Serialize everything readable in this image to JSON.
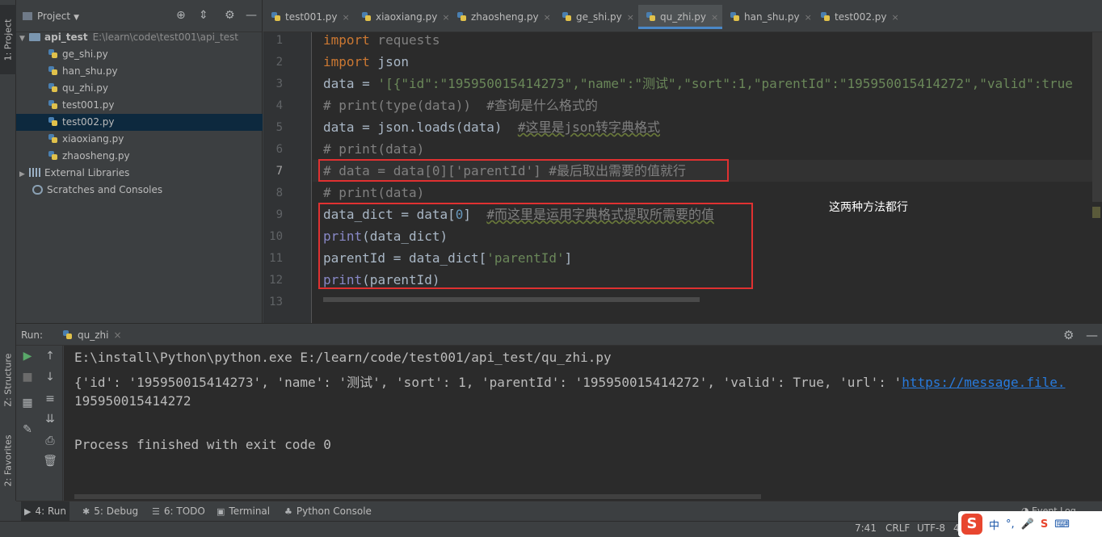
{
  "left_strip": {
    "project_tab": "1: Project",
    "structure_tab": "Z: Structure",
    "favorites_tab": "2: Favorites"
  },
  "project_panel": {
    "title": "Project",
    "root": {
      "name": "api_test",
      "path": "E:\\learn\\code\\test001\\api_test"
    },
    "files": [
      "ge_shi.py",
      "han_shu.py",
      "qu_zhi.py",
      "test001.py",
      "test002.py",
      "xiaoxiang.py",
      "zhaosheng.py"
    ],
    "selected_file": "test002.py",
    "external_libraries": "External Libraries",
    "scratches": "Scratches and Consoles"
  },
  "editor_tabs": [
    "test001.py",
    "xiaoxiang.py",
    "zhaosheng.py",
    "ge_shi.py",
    "qu_zhi.py",
    "han_shu.py",
    "test002.py"
  ],
  "active_tab": "qu_zhi.py",
  "editor": {
    "line_numbers": [
      "1",
      "2",
      "3",
      "4",
      "5",
      "6",
      "7",
      "8",
      "9",
      "10",
      "11",
      "12",
      "13"
    ],
    "lines": {
      "l1_kw": "import",
      "l1_rest": " requests",
      "l2_kw": "import",
      "l2_rest": " json",
      "l3_var": "data = ",
      "l3_str": "'[{\"id\":\"195950015414273\",\"name\":\"测试\",\"sort\":1,\"parentId\":\"195950015414272\",\"valid\":true",
      "l4": "# print(type(data))  #查询是什么格式的",
      "l5_code": "data = json.loads(data)  ",
      "l5_cm": "#这里是json转字典格式",
      "l6": "# print(data)",
      "l7": "# data = data[0]['parentId'] #最后取出需要的值就行",
      "l8": "# print(data)",
      "l9_code": "data_dict = data[",
      "l9_num": "0",
      "l9_close": "]  ",
      "l9_cm": "#而这里是运用字典格式提取所需要的值",
      "l10_fn": "print",
      "l10_rest": "(data_dict)",
      "l11_code": "parentId = data_dict[",
      "l11_str": "'parentId'",
      "l11_close": "]",
      "l12_fn": "print",
      "l12_rest": "(parentId)"
    },
    "annotation": "这两种方法都行"
  },
  "run_panel": {
    "label": "Run:",
    "tab": "qu_zhi",
    "console": {
      "line1": "E:\\install\\Python\\python.exe E:/learn/code/test001/api_test/qu_zhi.py",
      "line2_text": "{'id': '195950015414273', 'name': '测试', 'sort': 1, 'parentId': '195950015414272', 'valid': True, 'url': '",
      "line2_link": "https://message.file.",
      "line3": "195950015414272",
      "line5": "Process finished with exit code 0"
    }
  },
  "bottom_bar": {
    "run": "4: Run",
    "debug": "5: Debug",
    "todo": "6: TODO",
    "terminal": "Terminal",
    "python_console": "Python Console",
    "event_log": "Event Log"
  },
  "status_bar": {
    "position": "7:41",
    "line_sep": "CRLF",
    "encoding": "UTF-8",
    "indent": "4"
  },
  "ime": {
    "logo": "S",
    "lang": "中",
    "punct": "°,",
    "mic": "🎤",
    "logo2": "S"
  },
  "colors": {
    "editor_bg": "#2b2b2b",
    "panel_bg": "#3c3f41",
    "keyword": "#cc7832",
    "string": "#6a8759",
    "comment": "#808080",
    "highlight_box": "#e03131",
    "link": "#287bde"
  }
}
